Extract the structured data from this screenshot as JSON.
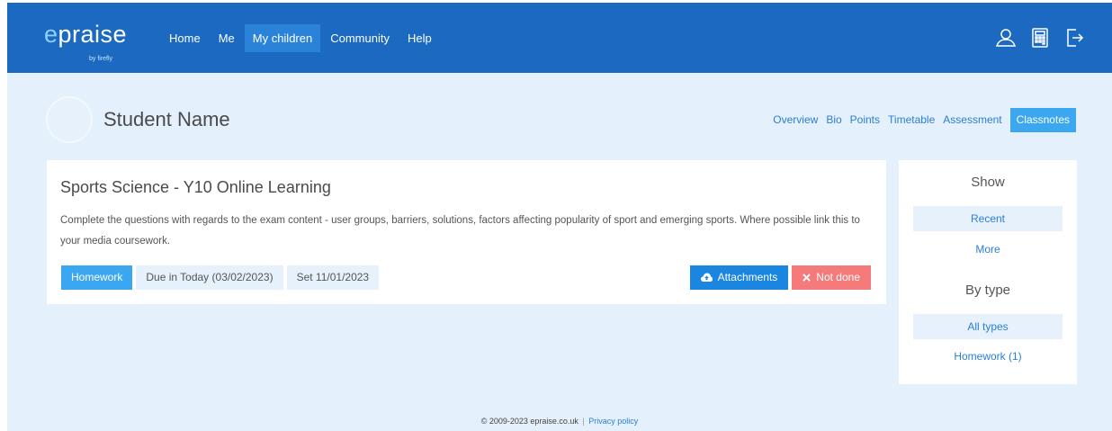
{
  "brand": {
    "logo_first": "e",
    "logo_rest": "praise",
    "logo_sub": "by firefly",
    "colors": {
      "header": "#1b69c0",
      "accent": "#3aa7f0",
      "danger": "#f57b7b",
      "background": "#e4f0fb"
    }
  },
  "nav": {
    "items": [
      {
        "label": "Home"
      },
      {
        "label": "Me"
      },
      {
        "label": "My children",
        "active": true
      },
      {
        "label": "Community"
      },
      {
        "label": "Help"
      }
    ]
  },
  "header_icons": [
    "user-icon",
    "calculator-icon",
    "logout-icon"
  ],
  "student": {
    "name": "Student Name",
    "tabs": [
      {
        "label": "Overview"
      },
      {
        "label": "Bio"
      },
      {
        "label": "Points"
      },
      {
        "label": "Timetable"
      },
      {
        "label": "Assessment"
      },
      {
        "label": "Classnotes",
        "active": true
      }
    ]
  },
  "classnote": {
    "title": "Sports Science - Y10 Online Learning",
    "description": "Complete the questions with regards to the exam content - user groups, barriers, solutions, factors affecting popularity of sport and emerging sports. Where possible link this to your media coursework.",
    "type_tag": "Homework",
    "due": "Due in Today (03/02/2023)",
    "set": "Set 11/01/2023",
    "attachments_label": "Attachments",
    "status_label": "Not done"
  },
  "sidebar": {
    "show_heading": "Show",
    "show_items": [
      {
        "label": "Recent",
        "selected": true
      },
      {
        "label": "More",
        "selected": false
      }
    ],
    "type_heading": "By type",
    "type_items": [
      {
        "label": "All types",
        "selected": true
      },
      {
        "label": "Homework (1)",
        "selected": false
      }
    ]
  },
  "footer": {
    "copyright": "© 2009-2023 epraise.co.uk",
    "separator": "|",
    "privacy": "Privacy policy"
  }
}
